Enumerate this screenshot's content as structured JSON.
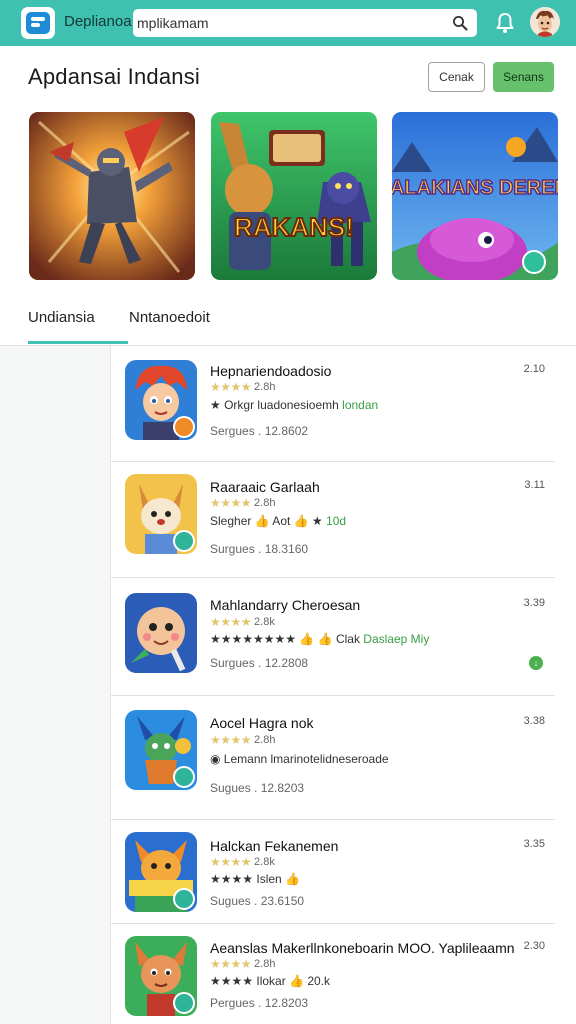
{
  "topbar": {
    "app_name": "Deplianoa",
    "search_value": "mplikamam",
    "icons": [
      "logo-icon",
      "search-icon",
      "bell-icon",
      "avatar"
    ],
    "accent_color": "#3ec1b0"
  },
  "header": {
    "title": "Apdansai Indansi",
    "cancel_label": "Cenak",
    "primary_label": "Senans"
  },
  "banners": [
    {
      "text": ""
    },
    {
      "text": "RAKANS!"
    },
    {
      "text": "KALAKIANS DERENI"
    }
  ],
  "tabs": [
    {
      "label": "Undiansia"
    },
    {
      "label": "Nntanoedoit"
    }
  ],
  "apps": [
    {
      "title": "Hepnariendoadosio",
      "stars_label": "2.8h",
      "meta": "★ Orkgr luadonesioemh",
      "meta_green": "londan",
      "sub": "Sergues . 12.8602",
      "version": "2.10"
    },
    {
      "title": "Raaraaic Garlaah",
      "stars_label": "2.8h",
      "meta": "Slegher 👍 Aot 👍 ★",
      "meta_green": "10d",
      "sub": "Surgues . 18.3160",
      "version": "3.11"
    },
    {
      "title": "Mahlandarry Cheroesan",
      "stars_label": "2.8k",
      "meta": "★★★★★★★★ 👍 👍 Clak",
      "meta_green": "Daslaep Miy",
      "sub": "Surgues . 12.2808",
      "version": "3.39"
    },
    {
      "title": "Aocel Hagra nok",
      "stars_label": "2.8h",
      "meta": "◉ Lemann lmarinotelidneseroade",
      "meta_green": "",
      "sub": "Sugues . 12.8203",
      "version": "3.38"
    },
    {
      "title": "Halckan Fekanemen",
      "stars_label": "2.8k",
      "meta": "★★★★ Islen 👍",
      "meta_green": "",
      "sub": "Sugues . 23.6150",
      "version": "3.35"
    },
    {
      "title": "Aeanslas Makerllnkoneboarin MOO. Yaplileaamn",
      "stars_label": "2.8h",
      "meta": "★★★★ Ilokar 👍 20.k",
      "meta_green": "",
      "sub": "Pergues . 12.8203",
      "version": "2.30"
    }
  ]
}
